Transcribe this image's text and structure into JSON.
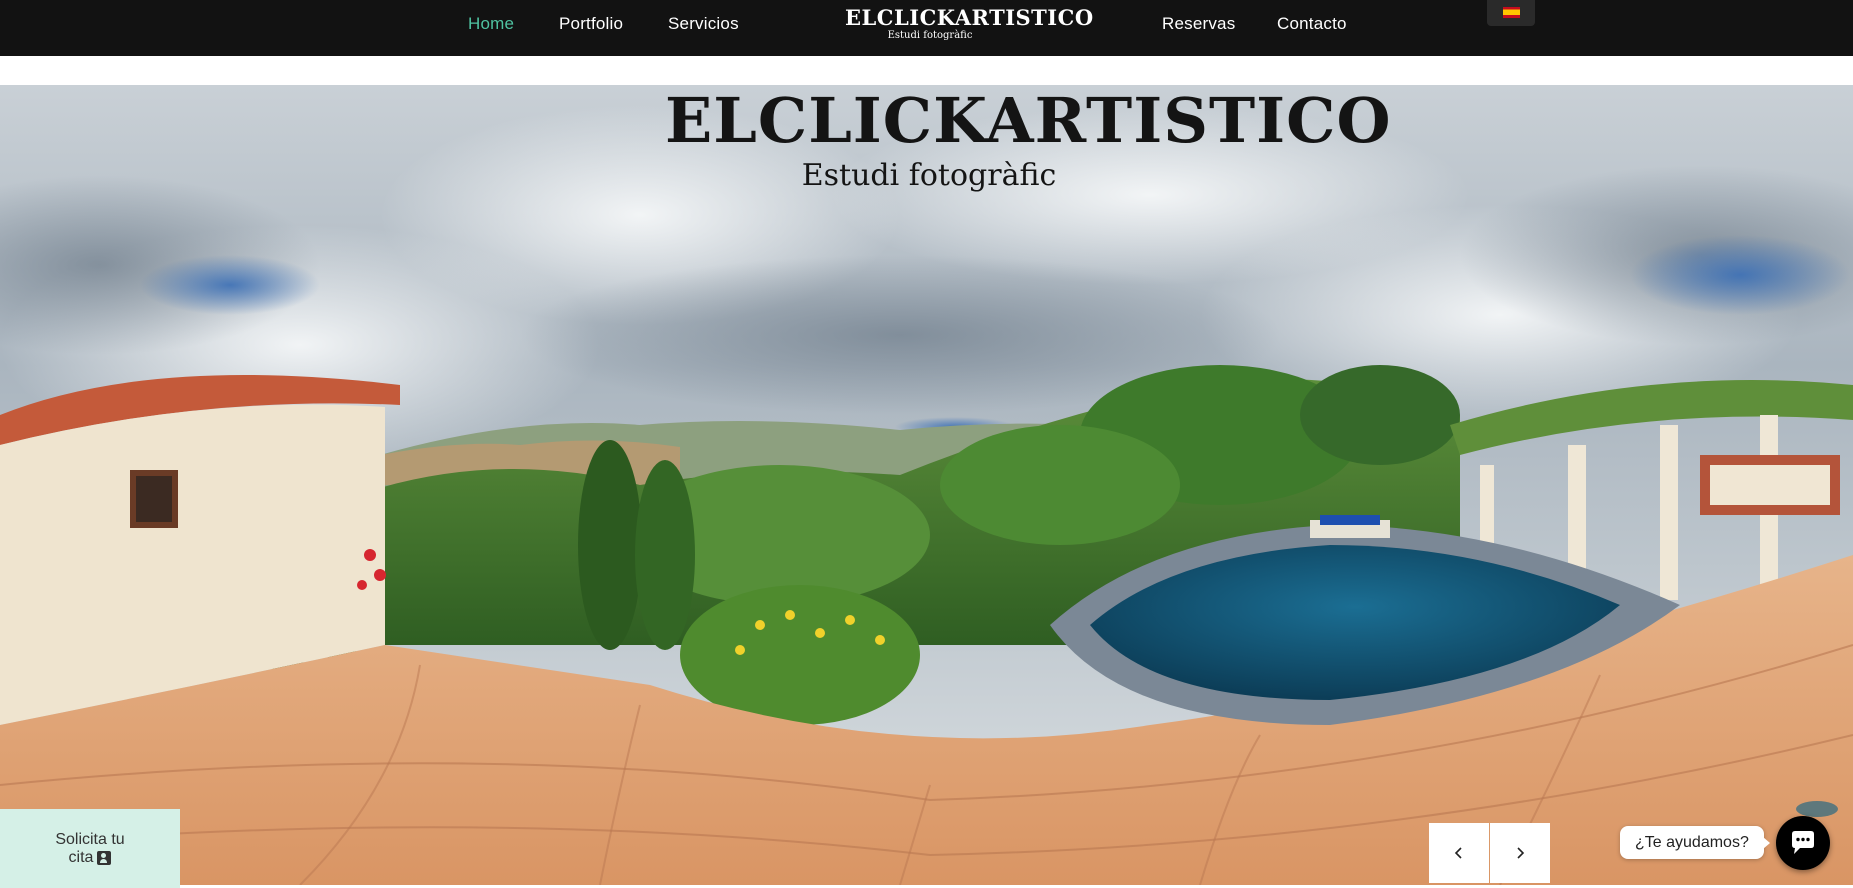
{
  "nav": {
    "links": {
      "home": "Home",
      "portfolio": "Portfolio",
      "servicios": "Servicios",
      "reservas": "Reservas",
      "contacto": "Contacto"
    },
    "active": "home",
    "active_color": "#4fc3a1",
    "logo_main": "ELCLICKARTISTICO",
    "logo_sub": "Estudi fotogràfic",
    "language_flag": "spain-flag-icon",
    "bar_color": "#121212"
  },
  "hero": {
    "logo_main": "ELCLICKARTISTICO",
    "logo_sub": "Estudi fotogràfic",
    "image": "360-panorama-villa-with-pool-and-hills"
  },
  "cta": {
    "line1": "Solicita tu",
    "line2": "cita",
    "icon": "contact-card-icon",
    "background": "#d5f0e7"
  },
  "slider": {
    "prev_icon": "chevron-left-icon",
    "next_icon": "chevron-right-icon"
  },
  "help": {
    "bubble_text": "¿Te ayudamos?",
    "chat_icon": "chat-bubble-icon"
  }
}
